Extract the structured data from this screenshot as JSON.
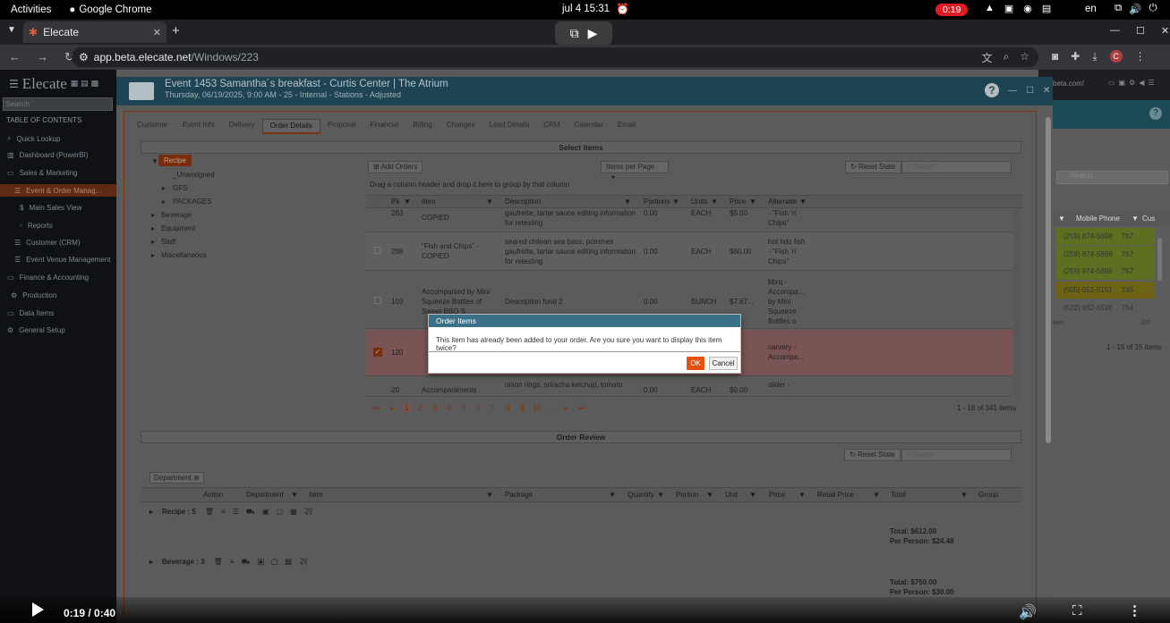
{
  "os": {
    "activities": "Activities",
    "app_name": "Google Chrome",
    "clock": "jul 4  15:31",
    "recording": "0:19",
    "lang": "en"
  },
  "browser": {
    "tab_title": "Elecate",
    "url_host": "app.beta.elecate.net",
    "url_path": "/Windows/223"
  },
  "sidebar": {
    "logo": "Elecate",
    "search_placeholder": "Search",
    "toc": "TABLE OF CONTENTS",
    "items": [
      {
        "label": "Quick Lookup"
      },
      {
        "label": "Dashboard (PowerBI)"
      },
      {
        "label": "Sales & Marketing"
      },
      {
        "label": "Event & Order Manag..."
      },
      {
        "label": "Main Sales View"
      },
      {
        "label": "Reports"
      },
      {
        "label": "Customer (CRM)"
      },
      {
        "label": "Event Venue Management"
      },
      {
        "label": "Finance & Accounting"
      },
      {
        "label": "Production"
      },
      {
        "label": "Data Items"
      },
      {
        "label": "General Setup"
      }
    ]
  },
  "background_grid": {
    "header_text": "beta.com!",
    "search_placeholder": "Search...",
    "col_mobile": "Mobile Phone",
    "col_cus": "Cus",
    "rows": [
      {
        "phone": "(259) 874-5698",
        "code": "767"
      },
      {
        "phone": "(259) 874-5698",
        "code": "767"
      },
      {
        "phone": "(259) 874-5698",
        "code": "767"
      },
      {
        "phone": "(505) 051-5151",
        "code": "745"
      },
      {
        "phone": "(622) 662-6526",
        "code": "764"
      }
    ],
    "partial": "107",
    "partial_label": "ines",
    "pager_info": "1 - 15 of 15 items"
  },
  "window": {
    "title": "Event 1453 Samantha´s breakfast - Curtis Center | The Atrium",
    "subtitle": "Thursday, 06/19/2025, 9:00 AM - 25 - Internal - Stations - Adjusted"
  },
  "tabs": [
    "Customer",
    "Event Info",
    "Delivery",
    "Order Details",
    "Proposal",
    "Financial",
    "Billing",
    "Changes",
    "Lead Details",
    "CRM",
    "Calendar",
    "Email"
  ],
  "select_items": {
    "title": "Select Items",
    "tree": {
      "recipe": "Recipe",
      "unassigned": "_Unassigned",
      "gfs": "GFS",
      "packages": "PACKAGES",
      "beverage": "Beverage",
      "equipment": "Equipment",
      "staff": "Staff",
      "misc": "Miscellaneous"
    },
    "add_orders": "Add Orders",
    "items_per_page": "Items per Page",
    "reset_state": "Reset State",
    "search_placeholder": "Search...",
    "drag_hint": "Drag a column header and drop it here to group by that column",
    "columns": {
      "pk": "Pk",
      "item": "Item",
      "description": "Description",
      "portions": "Portions",
      "units": "Units",
      "price": "Price",
      "alternate": "Alternate"
    },
    "rows": [
      {
        "pk": "283",
        "item": "COPIED",
        "desc1": "gaufrette, tartar sauce editing information",
        "desc2": "for retesting",
        "portions": "0.00",
        "units": "EACH",
        "price": "$5.00",
        "alt1": "- \"Fish 'n'",
        "alt2": "Chips\""
      },
      {
        "pk": "298",
        "item1": "\"Fish and Chips\" -",
        "item2": "COPIED",
        "desc1": "seared chilean sea bass, pommes",
        "desc2": "gaufrette, tartar sauce editing information",
        "desc3": "for retesting",
        "portions": "0.00",
        "units": "EACH",
        "price": "$60.00",
        "alt1": "hot hdo fish",
        "alt2": "- \"Fish 'n'",
        "alt3": "Chips\""
      },
      {
        "pk": "103",
        "item1": "Accompanied by Mini",
        "item2": "Squeeze Bottles of",
        "item3": "Sweet BBQ S",
        "desc1": "Description food 2",
        "portions": "0.00",
        "units": "BUNCH",
        "price": "$7.67...",
        "alt1": "bbrq -",
        "alt2": "Accompa...",
        "alt3": "by Mini",
        "alt4": "Squeeze",
        "alt5": "Bottles o"
      },
      {
        "pk": "120",
        "portions": "",
        "alt1": "carvery -",
        "alt2": "Accompa..."
      },
      {
        "pk": "20",
        "item1": "Accompaniments",
        "desc1": "onion rings, sriracha ketchup, tomato",
        "portions": "0.00",
        "units": "EACH",
        "price": "$0.00",
        "alt1": "slider -"
      }
    ],
    "pages": [
      "1",
      "2",
      "3",
      "4",
      "5",
      "6",
      "7",
      "8",
      "9",
      "10",
      "..."
    ],
    "pager_info": "1 - 18 of 341 items"
  },
  "order_review": {
    "title": "Order Review",
    "reset_state": "Reset State",
    "search_placeholder": "Search...",
    "chip": "Department",
    "columns": {
      "action": "Action",
      "department": "Department",
      "item": "Item",
      "package": "Package",
      "quantity": "Quantity",
      "portion": "Portion",
      "unit": "Unit",
      "price": "Price",
      "retail": "Retail Price",
      "total": "Total",
      "group": "Group"
    },
    "groups": [
      {
        "label": "Recipe : 5",
        "total": "Total: $612.00",
        "per_person": "Per Person: $24.48"
      },
      {
        "label": "Beverage : 3",
        "total": "Total: $750.00",
        "per_person": "Per Person: $30.00"
      }
    ]
  },
  "dialog": {
    "title": "Order Items",
    "message": "This item has already been added to your order. Are you sure you want to display this item twice?",
    "ok": "OK",
    "cancel": "Cancel"
  },
  "video": {
    "time": "0:19 / 0:40"
  }
}
